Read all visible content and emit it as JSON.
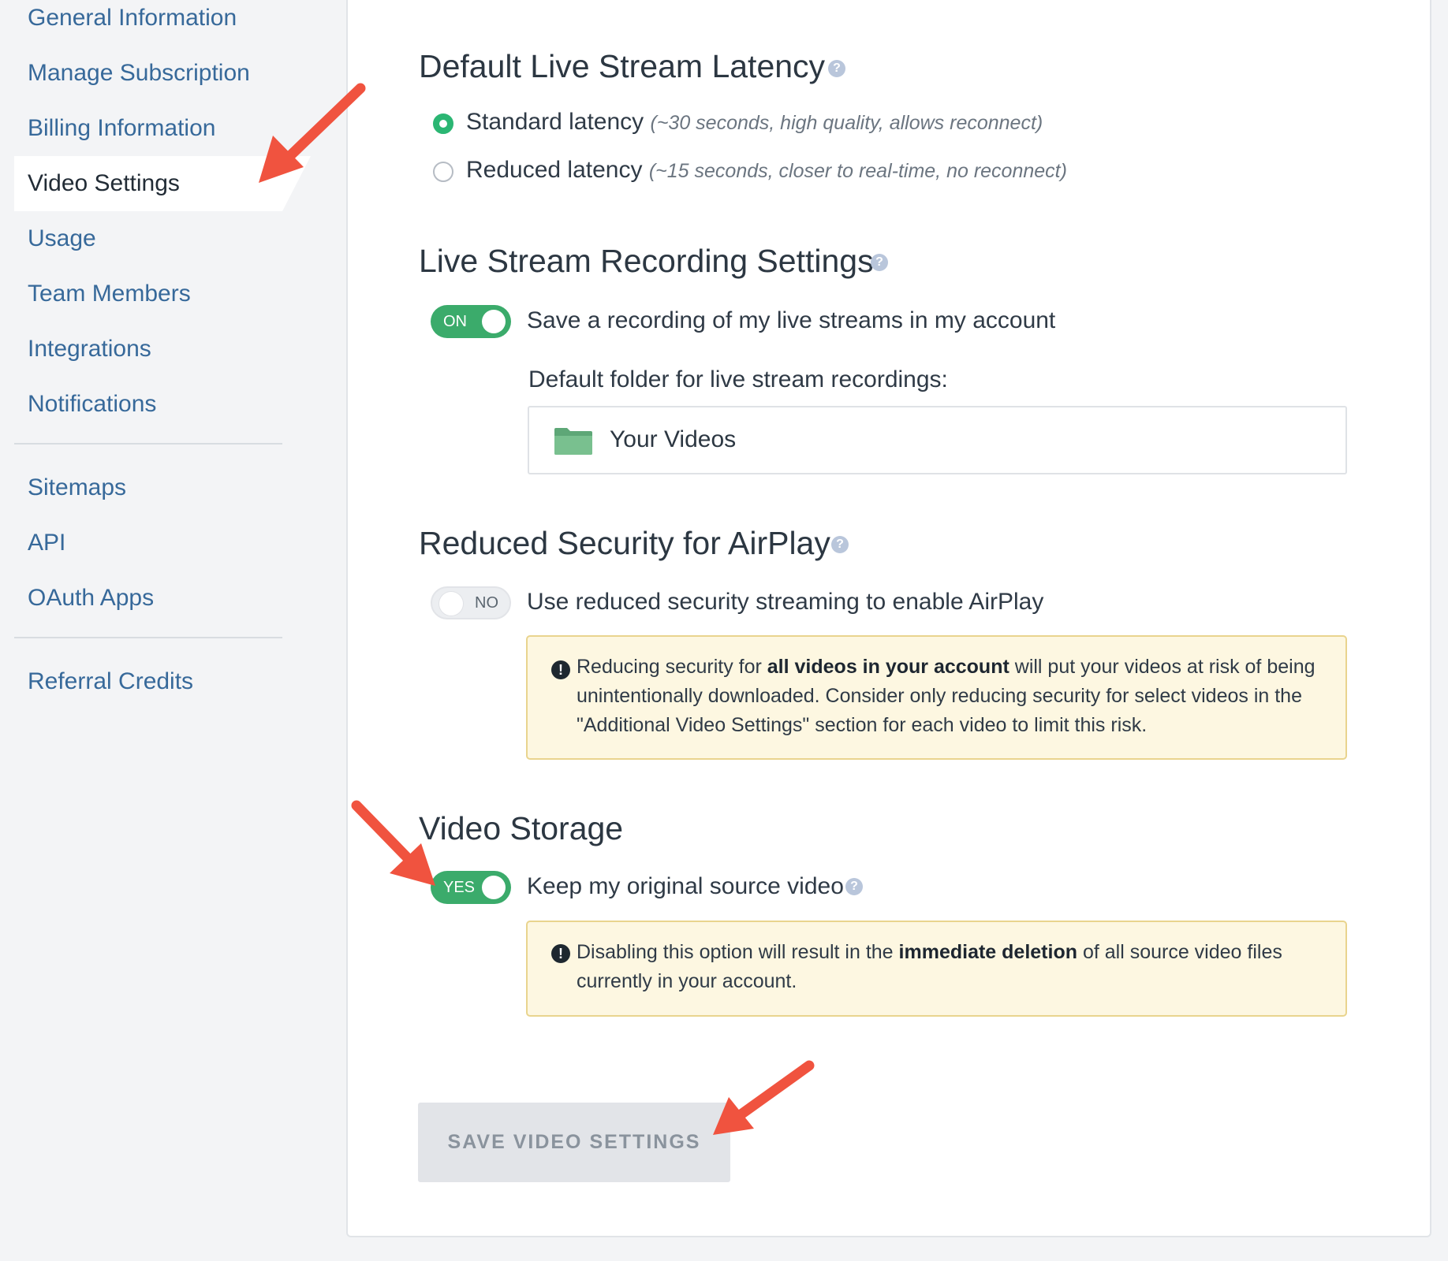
{
  "sidebar": {
    "items": [
      {
        "label": "General Information"
      },
      {
        "label": "Manage Subscription"
      },
      {
        "label": "Billing Information"
      },
      {
        "label": "Video Settings"
      },
      {
        "label": "Usage"
      },
      {
        "label": "Team Members"
      },
      {
        "label": "Integrations"
      },
      {
        "label": "Notifications"
      },
      {
        "label": "Sitemaps"
      },
      {
        "label": "API"
      },
      {
        "label": "OAuth Apps"
      },
      {
        "label": "Referral Credits"
      }
    ],
    "active": "Video Settings"
  },
  "latency": {
    "title": "Default Live Stream Latency",
    "options": [
      {
        "label": "Standard latency",
        "note": "(~30 seconds, high quality, allows reconnect)",
        "checked": true
      },
      {
        "label": "Reduced latency",
        "note": "(~15 seconds, closer to real-time, no reconnect)",
        "checked": false
      }
    ]
  },
  "recording": {
    "title": "Live Stream Recording Settings",
    "toggle_label": "ON",
    "toggle_on": true,
    "option_text": "Save a recording of my live streams in my account",
    "folder_label": "Default folder for live stream recordings:",
    "folder_name": "Your Videos"
  },
  "airplay": {
    "title": "Reduced Security for AirPlay",
    "toggle_label": "NO",
    "toggle_on": false,
    "option_text": "Use reduced security streaming to enable AirPlay",
    "warning": {
      "pre": "Reducing security for ",
      "bold": "all videos in your account",
      "post": " will put your videos at risk of being unintentionally downloaded. Consider only reducing security for select videos in the \"Additional Video Settings\" section for each video to limit this risk."
    }
  },
  "storage": {
    "title": "Video Storage",
    "toggle_label": "YES",
    "toggle_on": true,
    "option_text": "Keep my original source video",
    "warning": {
      "pre": "Disabling this option will result in the ",
      "bold": "immediate deletion",
      "post": " of all source video files currently in your account."
    }
  },
  "save_button": {
    "label": "SAVE VIDEO SETTINGS"
  },
  "colors": {
    "accent_green": "#3bab6b",
    "link_blue": "#37699a",
    "annotation_red": "#f0533f",
    "warning_bg": "#fdf7e1"
  }
}
